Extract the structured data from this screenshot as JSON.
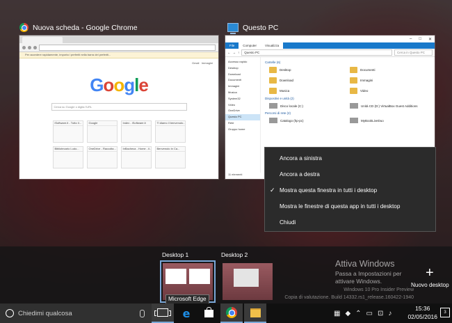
{
  "windows": {
    "chrome": {
      "title": "Nuova scheda - Google Chrome",
      "infobar": "Per accedere rapidamente, importa i preferiti nella barra dei preferiti...",
      "links": [
        "Gmail",
        "Immagini"
      ],
      "logo": "Google",
      "search_placeholder": "Cerca su Google o digita l'URL",
      "tiles": [
        "iSoftware.it - Tutto il...",
        "Google",
        "Index - iSoftware.it",
        "Ti diamo il benvenuto...",
        "Bibliotecario Ludo...",
        "OneDrive - Raccolta...",
        "InBacheca - Home - il...",
        "Benvenuto in Ca..."
      ]
    },
    "explorer": {
      "title": "Questo PC",
      "ribbon_tabs": [
        "File",
        "Computer",
        "Visualizza"
      ],
      "address": "Questo PC",
      "search_placeholder": "Cerca in Questo PC",
      "nav": [
        "Accesso rapido",
        "Desktop",
        "Download",
        "Documenti",
        "Immagini",
        "Musica",
        "System32",
        "Video",
        "OneDrive",
        "Questo PC",
        "Rete",
        "Gruppo home"
      ],
      "folders_header": "Cartelle (6)",
      "folders": [
        "Desktop",
        "Documenti",
        "Download",
        "Immagini",
        "Musica",
        "Video"
      ],
      "devices_header": "Dispositivi e unità (2)",
      "devices": [
        "Disco locale (C:)",
        "Unità CD (D:) VirtualBox Guest Additions"
      ],
      "network_header": "Percorsi di rete (2)",
      "network": [
        "Catalogo (hp-pc)",
        "MyBookLiveDuo"
      ],
      "status": "11 elementi"
    }
  },
  "context_menu": {
    "items": [
      {
        "label": "Ancora a sinistra",
        "checked": false
      },
      {
        "label": "Ancora a destra",
        "checked": false
      },
      {
        "label": "Mostra questa finestra in tutti i desktop",
        "checked": true
      },
      {
        "label": "Mostra le finestre di questa app in tutti i desktop",
        "checked": false
      },
      {
        "label": "Chiudi",
        "checked": false
      }
    ],
    "check_glyph": "✓"
  },
  "desktops": {
    "items": [
      {
        "label": "Desktop 1",
        "active": true
      },
      {
        "label": "Desktop 2",
        "active": false
      }
    ],
    "tooltip": "Microsoft Edge",
    "new_desktop_label": "Nuovo desktop",
    "new_desktop_icon": "+"
  },
  "watermark": {
    "title": "Attiva Windows",
    "subtitle": "Passa a Impostazioni per attivare Windows.",
    "build_line1": "Windows 10 Pro Insider Preview",
    "build_line2": "Copia di valutazione. Build 14332.rs1_release.160422-1940"
  },
  "taskbar": {
    "search_placeholder": "Chiedimi qualcosa",
    "pinned": [
      "task-view-icon",
      "edge-icon",
      "store-icon",
      "chrome-icon",
      "file-explorer-icon"
    ],
    "time": "15:36",
    "date": "02/05/2016",
    "notification_count": "3"
  }
}
